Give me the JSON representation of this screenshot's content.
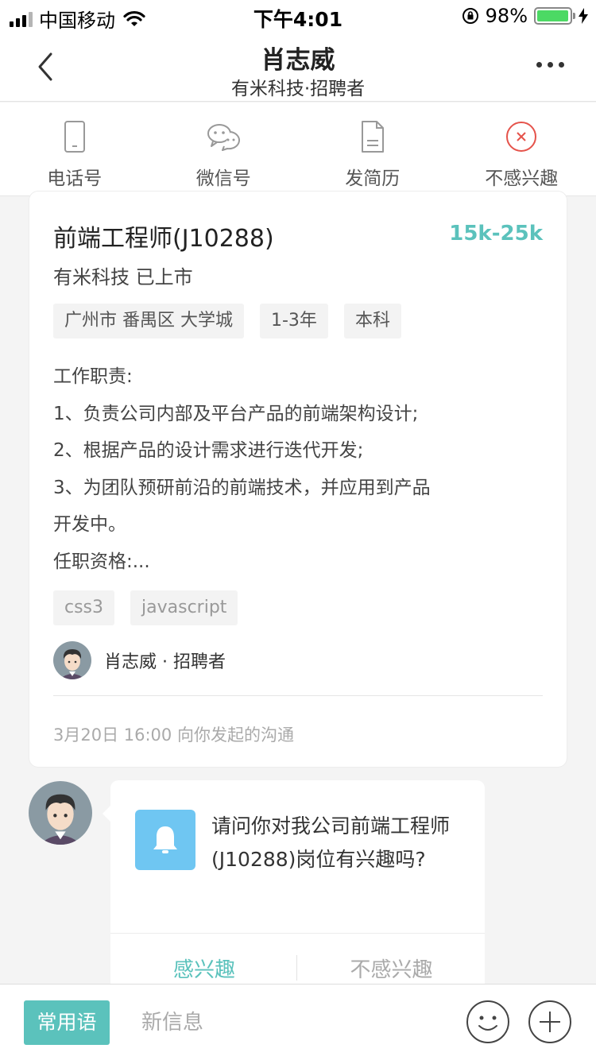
{
  "status_bar": {
    "carrier": "中国移动",
    "time": "下午4:01",
    "battery": "98%",
    "battery_level": 0.98
  },
  "header": {
    "title": "肖志威",
    "subtitle": "有米科技·招聘者"
  },
  "actions": [
    {
      "label": "电话号",
      "icon": "phone-icon"
    },
    {
      "label": "微信号",
      "icon": "wechat-icon"
    },
    {
      "label": "发简历",
      "icon": "resume-icon"
    },
    {
      "label": "不感兴趣",
      "icon": "close-circle-icon"
    }
  ],
  "job": {
    "title": "前端工程师(J10288)",
    "salary": "15k-25k",
    "company": "有米科技 已上市",
    "tags": [
      "广州市 番禺区 大学城",
      "1-3年",
      "本科"
    ],
    "description": [
      "工作职责:",
      "1、负责公司内部及平台产品的前端架构设计;",
      "2、根据产品的设计需求进行迭代开发;",
      "3、为团队预研前沿的前端技术，并应用到产品",
      "开发中。",
      "任职资格:..."
    ],
    "skills": [
      "css3",
      "javascript"
    ],
    "recruiter": "肖志威 · 招聘者",
    "time_note": "3月20日 16:00 向你发起的沟通"
  },
  "chat": {
    "message": "请问你对我公司前端工程师(J10288)岗位有兴趣吗?",
    "interested_label": "感兴趣",
    "not_interested_label": "不感兴趣"
  },
  "bottom": {
    "phrases_label": "常用语",
    "input_placeholder": "新信息"
  },
  "colors": {
    "accent": "#5bc2bc",
    "bell": "#6fc6f2",
    "battery": "#4cd964",
    "danger": "#e5534b"
  }
}
